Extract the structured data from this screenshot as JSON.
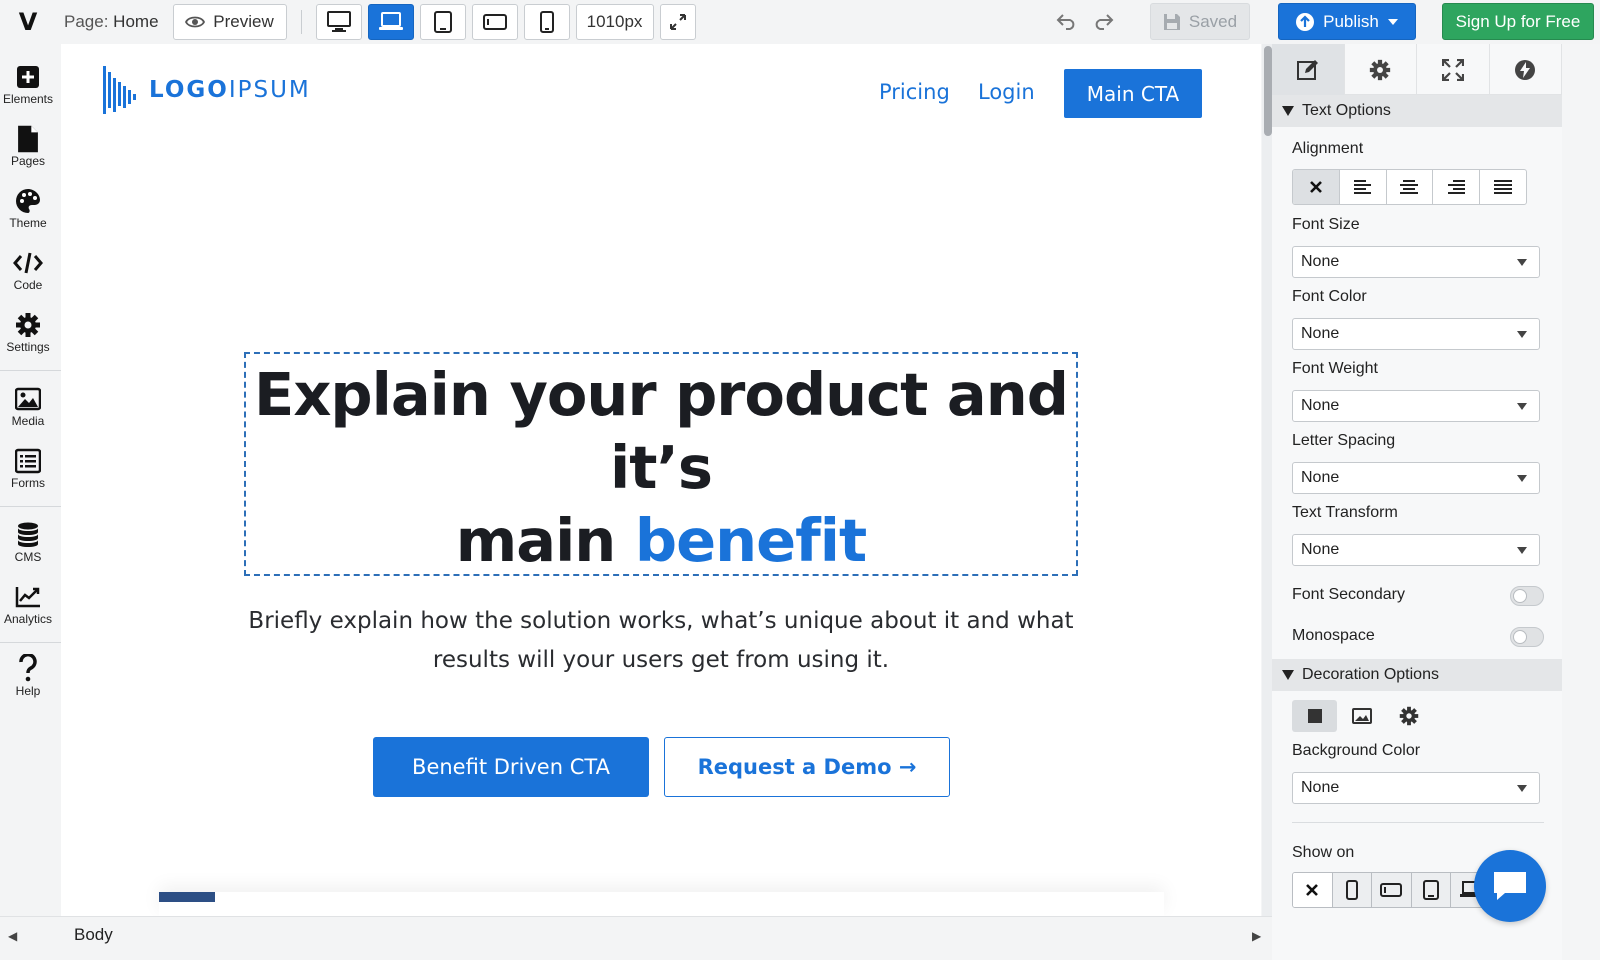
{
  "topbar": {
    "app_logo": "V",
    "page_prefix": "Page:",
    "page_name": "Home",
    "preview_label": "Preview",
    "width_value": "1010px",
    "saved_label": "Saved",
    "publish_label": "Publish",
    "signup_label": "Sign Up for Free"
  },
  "sidebar": {
    "items": [
      {
        "label": "Elements",
        "icon": "plus-square-icon"
      },
      {
        "label": "Pages",
        "icon": "page-icon"
      },
      {
        "label": "Theme",
        "icon": "palette-icon"
      },
      {
        "label": "Code",
        "icon": "code-icon"
      },
      {
        "label": "Settings",
        "icon": "gear-icon"
      },
      {
        "label": "Media",
        "icon": "image-icon"
      },
      {
        "label": "Forms",
        "icon": "form-list-icon"
      },
      {
        "label": "CMS",
        "icon": "database-icon"
      },
      {
        "label": "Analytics",
        "icon": "chart-line-icon"
      },
      {
        "label": "Help",
        "icon": "question-icon"
      }
    ]
  },
  "canvas": {
    "brand_bold": "LOGO",
    "brand_light": "IPSUM",
    "nav": [
      "Pricing",
      "Login"
    ],
    "main_cta": "Main CTA",
    "headline_line1": "Explain your product and it’s",
    "headline_line2_plain": "main ",
    "headline_line2_accent": "benefit",
    "subtext": "Briefly explain how the solution works, what’s unique about it and what results will your users get from using it.",
    "cta_primary": "Benefit Driven CTA",
    "cta_secondary": "Request a Demo →"
  },
  "bottombar": {
    "breadcrumb": "Body"
  },
  "panel": {
    "text_options_title": "Text Options",
    "alignment_label": "Alignment",
    "font_size_label": "Font Size",
    "font_size_value": "None",
    "font_color_label": "Font Color",
    "font_color_value": "None",
    "font_weight_label": "Font Weight",
    "font_weight_value": "None",
    "letter_spacing_label": "Letter Spacing",
    "letter_spacing_value": "None",
    "text_transform_label": "Text Transform",
    "text_transform_value": "None",
    "font_secondary_label": "Font Secondary",
    "monospace_label": "Monospace",
    "decoration_title": "Decoration Options",
    "bg_color_label": "Background Color",
    "bg_color_value": "None",
    "show_on_label": "Show on"
  },
  "colors": {
    "accent": "#1a73d9",
    "signup": "#2ea55f",
    "headline": "#1b1d22"
  }
}
